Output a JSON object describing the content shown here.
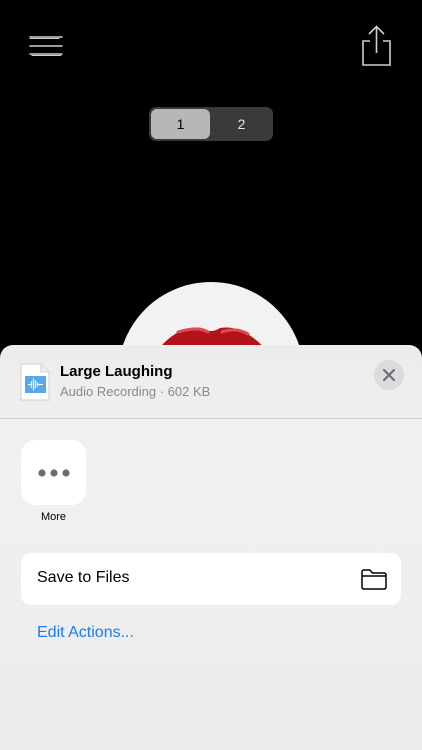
{
  "controls": {
    "menu_icon": "hamburger-menu-icon",
    "share_icon": "share-icon",
    "segments": [
      {
        "label": "1",
        "active": true
      },
      {
        "label": "2",
        "active": false
      }
    ]
  },
  "share_sheet": {
    "file_title": "Large Laughing",
    "file_subtitle": "Audio Recording · 602 KB",
    "file_icon": "audio-file-icon",
    "close_icon": "close-icon",
    "more_icon": "ellipsis-icon",
    "more_label": "More",
    "save_to_files_label": "Save to Files",
    "folder_icon": "folder-icon",
    "edit_actions_label": "Edit Actions..."
  },
  "colors": {
    "background": "#000000",
    "sheet": "#efefef",
    "accent_link": "#1e7cf2",
    "lips": "#b3141b"
  }
}
